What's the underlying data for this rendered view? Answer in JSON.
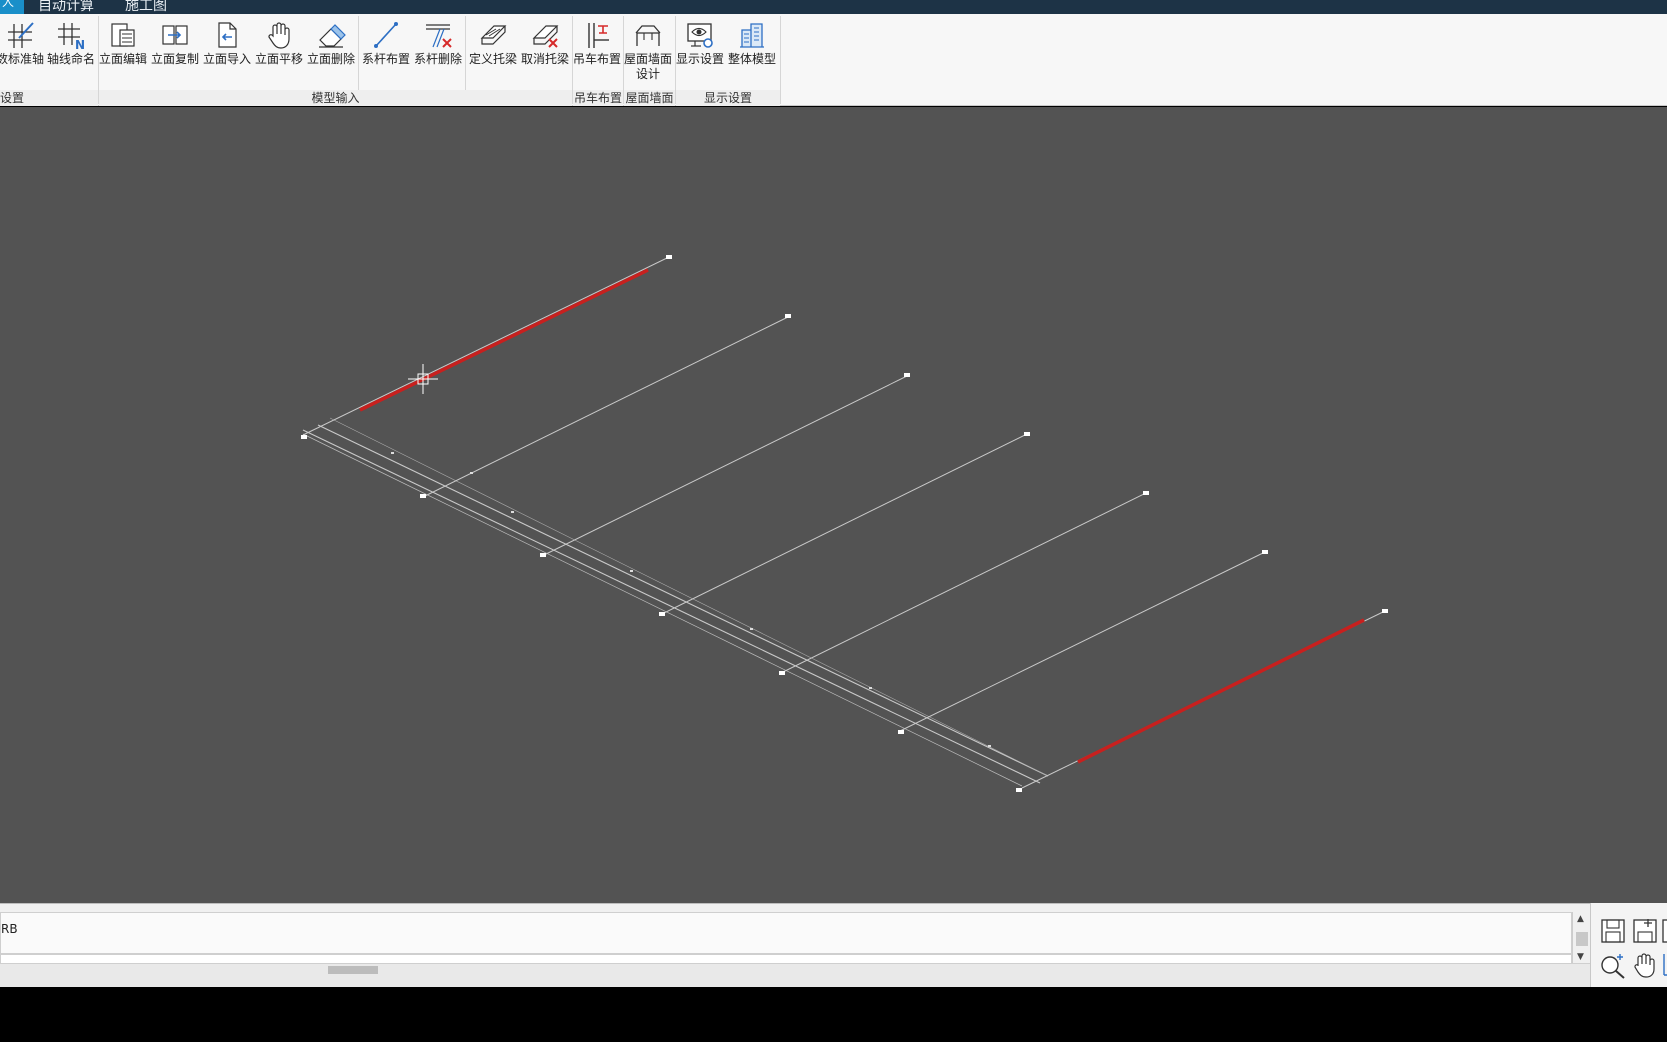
{
  "menu": {
    "active_tab": "人",
    "tabs": [
      "自动计算",
      "施工图"
    ]
  },
  "ribbon": {
    "buttons": [
      {
        "label": "数标准轴",
        "icon": "axis-standard-icon"
      },
      {
        "label": "轴线命名",
        "icon": "axis-name-icon"
      },
      {
        "label": "立面编辑",
        "icon": "elevation-edit-icon"
      },
      {
        "label": "立面复制",
        "icon": "elevation-copy-icon"
      },
      {
        "label": "立面导入",
        "icon": "elevation-import-icon"
      },
      {
        "label": "立面平移",
        "icon": "hand-pan-icon"
      },
      {
        "label": "立面删除",
        "icon": "eraser-icon"
      },
      {
        "label": "系杆布置",
        "icon": "tie-rod-place-icon"
      },
      {
        "label": "系杆删除",
        "icon": "tie-rod-delete-icon"
      },
      {
        "label": "定义托梁",
        "icon": "define-beam-icon"
      },
      {
        "label": "取消托梁",
        "icon": "cancel-beam-icon"
      },
      {
        "label": "吊车布置",
        "icon": "crane-place-icon"
      },
      {
        "label": "屋面墙面",
        "label2": "设计",
        "icon": "roof-wall-icon"
      },
      {
        "label": "显示设置",
        "icon": "display-settings-icon"
      },
      {
        "label": "整体模型",
        "icon": "whole-model-icon"
      }
    ],
    "groups": [
      {
        "label": "设置"
      },
      {
        "label": "模型输入"
      },
      {
        "label": "吊车布置"
      },
      {
        "label": "屋面墙面"
      },
      {
        "label": "显示设置"
      }
    ]
  },
  "command": {
    "history_text": "RB",
    "input_value": ""
  },
  "colors": {
    "viewport_bg": "#535353",
    "line": "#c8c8c8",
    "highlight": "#c8201e"
  }
}
